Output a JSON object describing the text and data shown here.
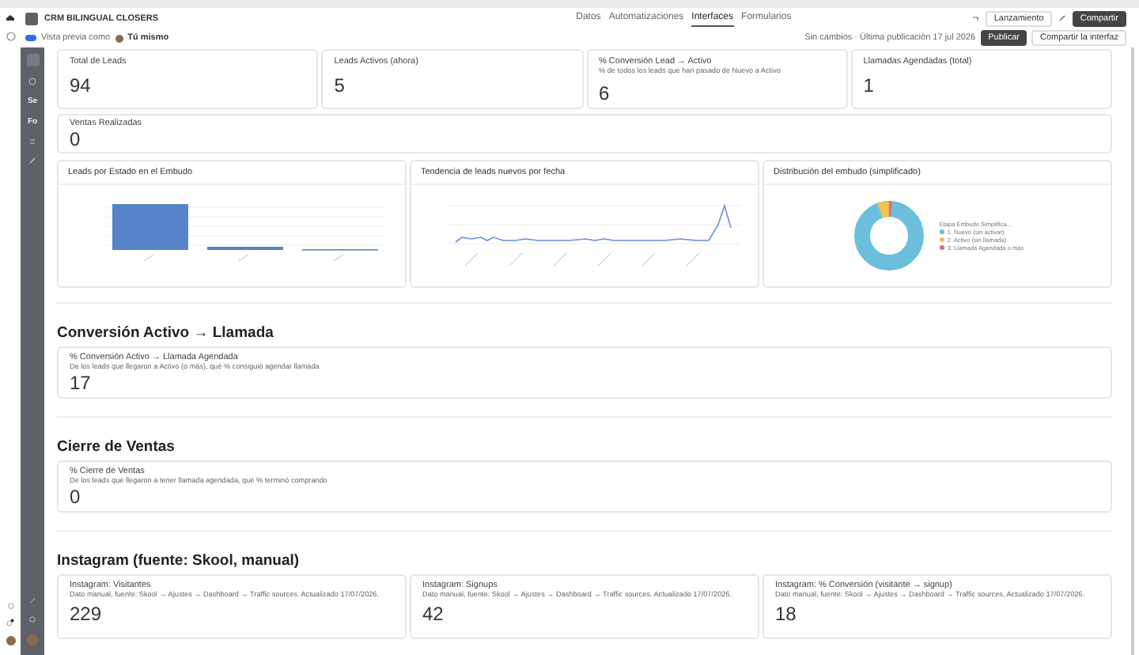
{
  "app": {
    "title": "CRM BILINGUAL CLOSERS"
  },
  "nav_tabs": [
    {
      "label": "Datos",
      "selected": false
    },
    {
      "label": "Automatizaciones",
      "selected": false
    },
    {
      "label": "Interfaces",
      "selected": true
    },
    {
      "label": "Formularios",
      "selected": false
    }
  ],
  "toolbar": {
    "launch": "Lanzamiento",
    "share": "Compartir"
  },
  "preview": {
    "on": true,
    "label": "Vista previa como",
    "user": "Tú mismo"
  },
  "publish_bar": {
    "status": "Sin cambios · Última publicación 17 jul 2026",
    "publish": "Publicar",
    "share_interface": "Compartir la interfaz"
  },
  "sidebar": {
    "items": [
      "Se",
      "Fo"
    ]
  },
  "metrics": [
    {
      "label": "Total de Leads",
      "value": "94"
    },
    {
      "label": "Leads Activos (ahora)",
      "value": "5"
    },
    {
      "label": "% Conversión Lead → Activo",
      "description": "% de todos los leads que han pasado de Nuevo a Activo",
      "value": "6"
    },
    {
      "label": "Llamadas Agendadas (total)",
      "value": "1"
    }
  ],
  "sales": {
    "label": "Ventas Realizadas",
    "value": "0"
  },
  "charts": [
    {
      "title": "Leads por Estado en el Embudo",
      "kind": "bar"
    },
    {
      "title": "Tendencia de leads nuevos por fecha",
      "kind": "line"
    },
    {
      "title": "Distribución del embudo (simplificado)",
      "kind": "donut",
      "legend_title": "Etapa Embudo Simplifica...",
      "legend": [
        {
          "label": "1. Nuevo (sin activar)",
          "color": "#6bbfdc"
        },
        {
          "label": "2. Activo (sin llamada)",
          "color": "#f2c14e"
        },
        {
          "label": "3. Llamada Agendada o más",
          "color": "#e8677a"
        }
      ]
    }
  ],
  "sections": [
    {
      "heading": "Conversión Activo → Llamada",
      "cards": [
        {
          "label": "% Conversión Activo → Llamada Agendada",
          "description": "De los leads que llegaron a Activo (o más), qué % consiguió agendar llamada",
          "value": "17"
        }
      ]
    },
    {
      "heading": "Cierre de Ventas",
      "cards": [
        {
          "label": "% Cierre de Ventas",
          "description": "De los leads que llegaron a tener llamada agendada, qué % terminó comprando",
          "value": "0"
        }
      ]
    },
    {
      "heading": "Instagram (fuente: Skool, manual)",
      "cards": [
        {
          "label": "Instagram: Visitantes",
          "description": "Dato manual, fuente: Skool → Ajustes → Dashboard → Traffic sources. Actualizado 17/07/2026.",
          "value": "229"
        },
        {
          "label": "Instagram: Signups",
          "description": "Dato manual, fuente: Skool → Ajustes → Dashboard → Traffic sources. Actualizado 17/07/2026.",
          "value": "42"
        },
        {
          "label": "Instagram: % Conversión (visitante → signup)",
          "description": "Dato manual, fuente: Skool → Ajustes → Dashboard → Traffic sources. Actualizado 17/07/2026.",
          "value": "18"
        }
      ]
    }
  ]
}
